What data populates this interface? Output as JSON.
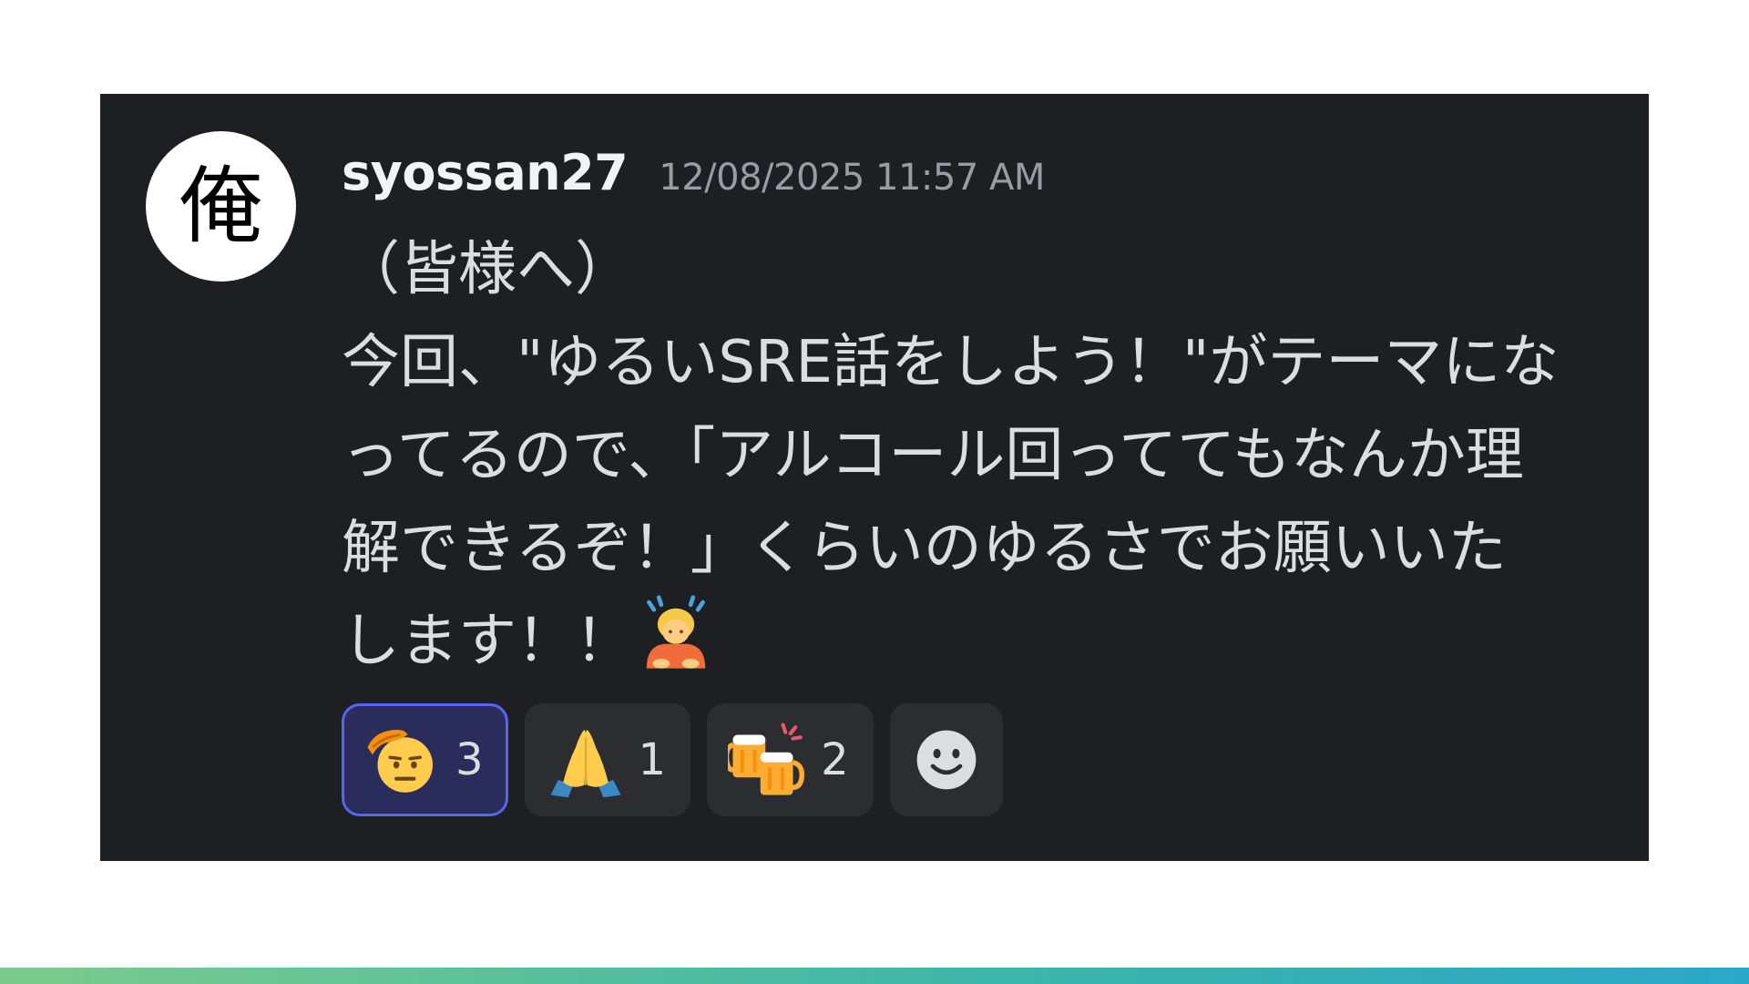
{
  "message": {
    "avatar_char": "俺",
    "username": "syossan27",
    "timestamp": "12/08/2025 11:57 AM",
    "greeting": "（皆様へ）",
    "body_lines": [
      "今回、\"ゆるいSRE話をしよう！\"がテーマにな",
      "ってるので、「アルコール回っててもなんか理",
      "解できるぞ！」くらいのゆるさでお願いいた",
      "します！！"
    ],
    "inline_emoji": "person-bowing-icon"
  },
  "reactions": [
    {
      "emoji": "saluting-face-icon",
      "count": "3",
      "active": true
    },
    {
      "emoji": "folded-hands-icon",
      "count": "1",
      "active": false
    },
    {
      "emoji": "clinking-beer-mugs-icon",
      "count": "2",
      "active": false
    }
  ],
  "add_reaction_icon": "add-reaction-smiley-icon",
  "colors": {
    "card_background": "#1e1f22",
    "active_reaction_border": "#5865f2",
    "active_reaction_bg": "#2a2d5c",
    "reaction_bg": "#2b2d31"
  }
}
